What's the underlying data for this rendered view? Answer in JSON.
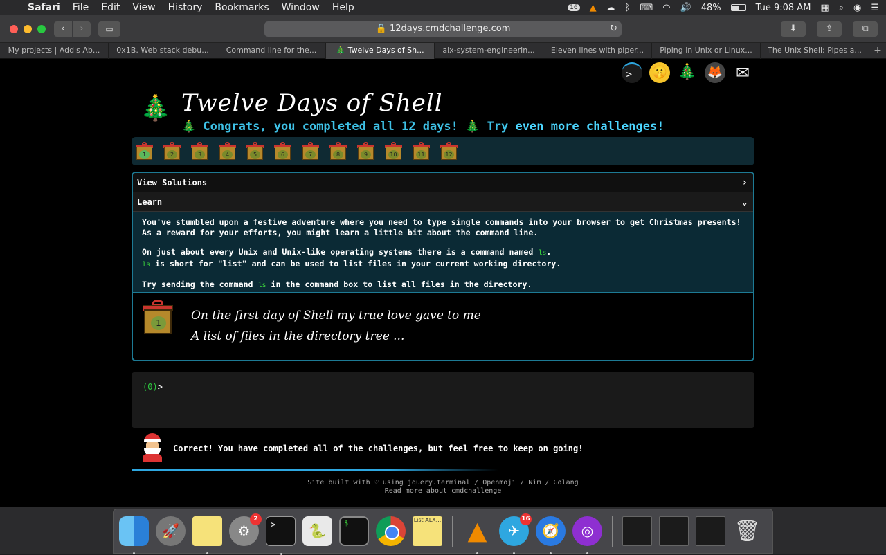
{
  "menubar": {
    "apple": "",
    "app": "Safari",
    "items": [
      "File",
      "Edit",
      "View",
      "History",
      "Bookmarks",
      "Window",
      "Help"
    ],
    "status": {
      "battery": "48%",
      "clock": "Tue 9:08 AM",
      "notif_badge": "16"
    }
  },
  "browser": {
    "url": "12days.cmdchallenge.com",
    "tabs": [
      "My projects | Addis Ab...",
      "0x1B. Web stack debu...",
      "Command line for the...",
      "Twelve Days of Sh...",
      "alx-system-engineerin...",
      "Eleven lines with piper...",
      "Piping in Unix or Linux...",
      "The Unix Shell: Pipes a..."
    ],
    "active_tab": 3
  },
  "page": {
    "title": "Twelve Days of Shell",
    "congrats": "Congrats, you completed all 12 days!",
    "try": "Try",
    "more": "even more challenges!",
    "gifts": [
      "1",
      "2",
      "3",
      "4",
      "5",
      "6",
      "7",
      "8",
      "9",
      "10",
      "11",
      "12"
    ],
    "view_solutions": "View Solutions",
    "learn": "Learn",
    "learn_p1": "You've stumbled upon a festive adventure where you need to type single commands into your browser to get Christmas presents! As a reward for your efforts, you might learn a little bit about the command line.",
    "learn_p2a": "On just about every Unix and Unix-like operating systems there is a command named",
    "learn_p2_cmd": "ls",
    "learn_p2b": "is short for \"list\" and can be used to list files in your current working directory.",
    "learn_p3a": "Try sending the command",
    "learn_p3b": "in the command box to list all files in the directory.",
    "poem_gift": "1",
    "poem_line1": "On the first day of Shell my true love gave to me",
    "poem_line2": "A list of files in the directory tree ...",
    "prompt_status": "(0)",
    "prompt_symbol": ">",
    "correct": "Correct! You have completed all of the challenges, but feel free to keep on going!",
    "footer1": "Site built with ♡ using jquery.terminal / Openmoji / Nim / Golang",
    "footer2": "Read more about cmdchallenge"
  },
  "dock": {
    "sys_prefs_badge": "2",
    "telegram_badge": "16",
    "term_glyph": ">_",
    "iterm_glyph": "$",
    "stickies_text": "List ALX..."
  }
}
